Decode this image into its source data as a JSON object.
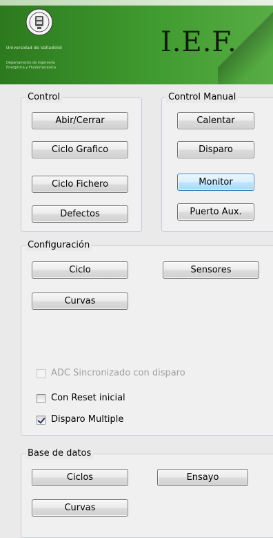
{
  "header": {
    "university": "Universidad de Valladolid",
    "department": [
      "Departamento de Ingeniería",
      "Energética y Fluidomecánica"
    ],
    "brand": "I.E.F."
  },
  "control": {
    "title": "Control",
    "buttons": [
      "Abir/Cerrar",
      "Ciclo Grafico",
      "Ciclo Fichero",
      "Defectos"
    ]
  },
  "control_manual": {
    "title": "Control Manual",
    "buttons": [
      "Calentar",
      "Disparo",
      "Monitor",
      "Puerto Aux."
    ],
    "focused": "Monitor"
  },
  "configuracion": {
    "title": "Configuración",
    "buttons": {
      "ciclo": "Ciclo",
      "sensores": "Sensores",
      "curvas": "Curvas"
    },
    "checkboxes": [
      {
        "label": "ADC Sincronizado con disparo",
        "checked": false,
        "enabled": false
      },
      {
        "label": "Con Reset inicial",
        "checked": false,
        "enabled": true
      },
      {
        "label": "Disparo Multiple",
        "checked": true,
        "enabled": true
      }
    ]
  },
  "base_datos": {
    "title": "Base de datos",
    "buttons": {
      "ciclos": "Ciclos",
      "ensayo": "Ensayo",
      "curvas": "Curvas"
    }
  },
  "colors": {
    "banner": "#3f9a2f",
    "focus": "#3c7fb1"
  }
}
